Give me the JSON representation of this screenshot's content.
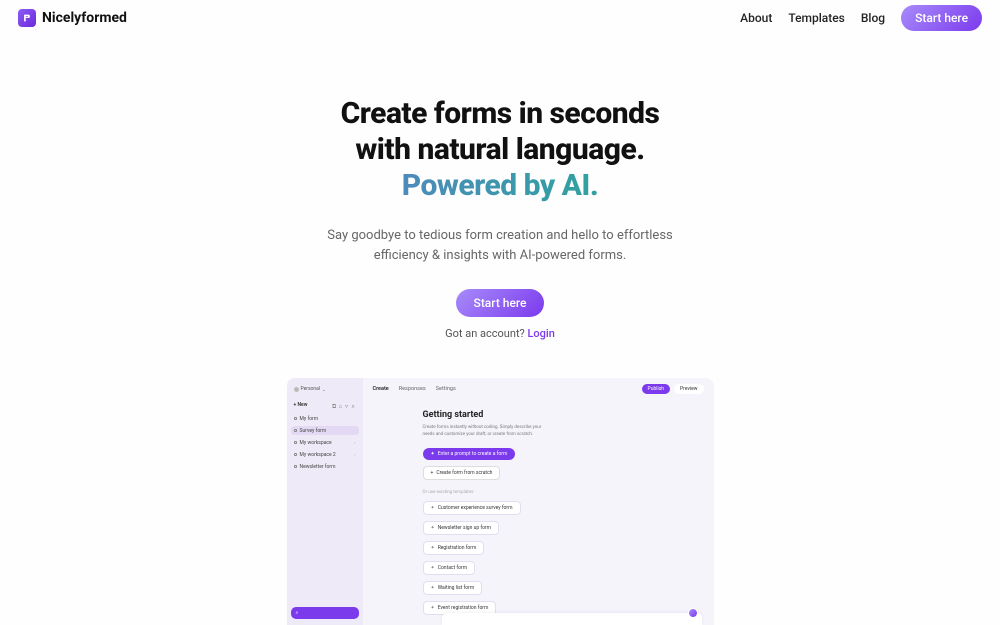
{
  "brand": {
    "name": "Nicelyformed"
  },
  "nav": {
    "about": "About",
    "templates": "Templates",
    "blog": "Blog",
    "cta": "Start here"
  },
  "hero": {
    "line1": "Create forms in seconds",
    "line2": "with natural language.",
    "line3": "Powered by AI.",
    "sub1": "Say goodbye to tedious form creation and hello to effortless",
    "sub2": "efficiency & insights with AI-powered forms.",
    "cta": "Start here",
    "login_prefix": "Got an account? ",
    "login": "Login"
  },
  "preview": {
    "workspace": "Personal",
    "new_label": "+ New",
    "sidebar_items": [
      {
        "label": "My form"
      },
      {
        "label": "Survey form",
        "active": true
      },
      {
        "label": "My workspace",
        "expandable": true
      },
      {
        "label": "My workspace 2",
        "expandable": true
      },
      {
        "label": "Newsletter form"
      }
    ],
    "tabs": {
      "create": "Create",
      "responses": "Responses",
      "settings": "Settings"
    },
    "publish": "Publish",
    "preview_btn": "Preview",
    "heading": "Getting started",
    "description1": "Create forms instantly without coding. Simply describe your",
    "description2": "needs and customize your draft, or create from scratch.",
    "prompt_btn": "Enter a prompt to create a form",
    "scratch_btn": "Create form from scratch",
    "or_text": "Or use existing templates:",
    "templates": [
      "Customer experience survey form",
      "Newsletter sign up form",
      "Registration form",
      "Contact form",
      "Waiting list form",
      "Event registration form"
    ]
  }
}
